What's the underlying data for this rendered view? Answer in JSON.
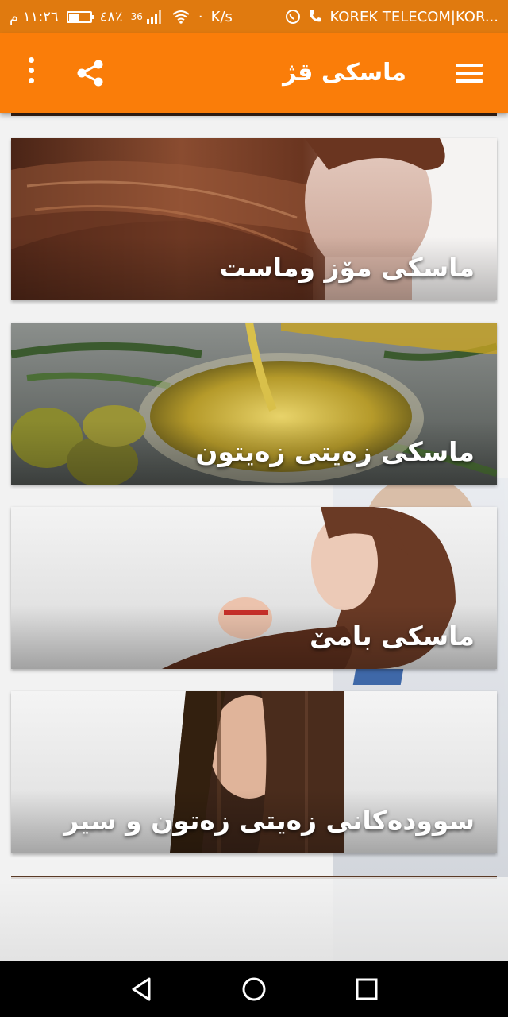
{
  "status_bar": {
    "time": "١١:٢٦ م",
    "battery": "٤٨٪",
    "network": "36",
    "speed": "K/s",
    "carrier": "KOREK TELECOM|KOR..."
  },
  "toolbar": {
    "title": "ماسکی قژ"
  },
  "cards": [
    {
      "title": "ماسکی مۆز وماست"
    },
    {
      "title": "ماسکی زەیتی زەیتون"
    },
    {
      "title": "ماسکی بامێ"
    },
    {
      "title": "سوودەکانی زەیتی زەتون و سیر"
    }
  ],
  "colors": {
    "status_bar": "#e07a0f",
    "toolbar": "#fa7d09"
  },
  "icons": {
    "menu": "hamburger-icon",
    "share": "share-icon",
    "more": "more-vert-icon",
    "back": "back-triangle-icon",
    "home": "home-circle-icon",
    "recents": "recents-square-icon"
  }
}
